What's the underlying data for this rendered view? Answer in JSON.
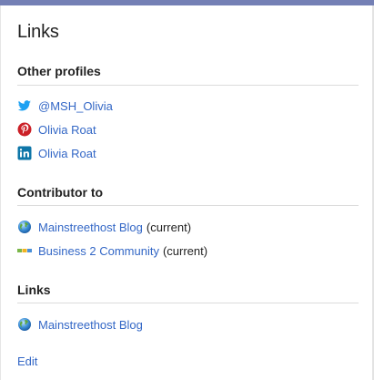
{
  "card": {
    "title": "Links"
  },
  "sections": {
    "other_profiles": {
      "heading": "Other profiles",
      "items": [
        {
          "label": "@MSH_Olivia",
          "icon": "twitter-icon"
        },
        {
          "label": "Olivia Roat",
          "icon": "pinterest-icon"
        },
        {
          "label": "Olivia Roat",
          "icon": "linkedin-icon"
        }
      ]
    },
    "contributor_to": {
      "heading": "Contributor to",
      "items": [
        {
          "label": "Mainstreethost Blog",
          "suffix": "(current)",
          "icon": "globe-icon"
        },
        {
          "label": "Business 2 Community",
          "suffix": "(current)",
          "icon": "site-favicon-icon"
        }
      ]
    },
    "links": {
      "heading": "Links",
      "items": [
        {
          "label": "Mainstreethost Blog",
          "icon": "globe-icon"
        }
      ]
    }
  },
  "footer": {
    "edit_label": "Edit"
  },
  "colors": {
    "link": "#3367c6",
    "top_bar": "#7480b5",
    "twitter": "#1da1f2",
    "pinterest": "#cb2027",
    "linkedin": "#0e76a8"
  }
}
